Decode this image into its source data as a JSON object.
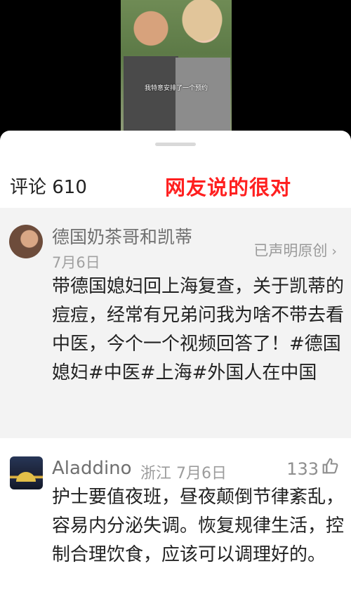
{
  "video": {
    "subtitle": "我特意安排了一个预约"
  },
  "comments": {
    "title": "评论 610",
    "highlight": "网友说的很对"
  },
  "post": {
    "author": "德国奶茶哥和凯蒂",
    "declared_label": "已声明原创",
    "date": "7月6日",
    "text": "带德国媳妇回上海复查，关于凯蒂的痘痘，经常有兄弟问我为啥不带去看中医，今个一个视频回答了！#德国媳妇#中医#上海#外国人在中国"
  },
  "reply": {
    "user": "Aladdino",
    "location": "浙江",
    "date": "7月6日",
    "likes": "133",
    "text": "护士要值夜班，昼夜颠倒节律紊乱，容易内分泌失调。恢复规律生活，控制合理饮食，应该可以调理好的。"
  }
}
